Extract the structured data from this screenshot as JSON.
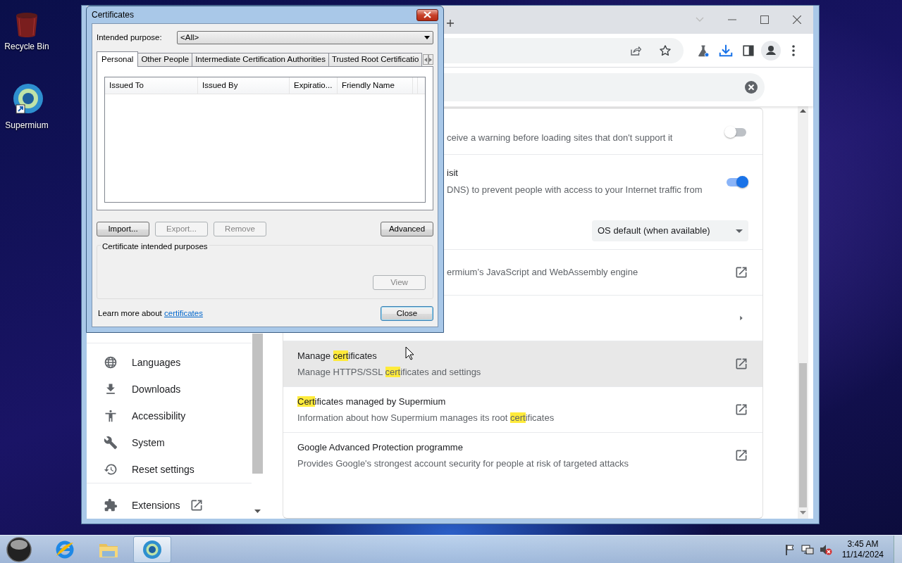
{
  "desktop_icons": [
    {
      "label": "Recycle Bin",
      "kind": "bin"
    },
    {
      "label": "Supermium",
      "kind": "browser"
    }
  ],
  "browser": {
    "sidebar": {
      "items": [
        {
          "label": "Languages",
          "kind": "languages"
        },
        {
          "label": "Downloads",
          "kind": "downloads"
        },
        {
          "label": "Accessibility",
          "kind": "accessibility"
        },
        {
          "label": "System",
          "kind": "system"
        },
        {
          "label": "Reset settings",
          "kind": "reset"
        },
        {
          "label": "Extensions",
          "kind": "extensions"
        }
      ]
    },
    "rows": [
      {
        "description": "ceive a warning before loading sites that don't support it",
        "control": {
          "kind": "toggle",
          "on": false
        },
        "hovered": false
      },
      {
        "title": "isit",
        "description": "DNS) to prevent people with access to your Internet traffic from",
        "control": {
          "kind": "toggle",
          "on": true
        },
        "select": {
          "value": "OS default (when available)"
        },
        "hovered": false
      },
      {
        "description": "ermium’s JavaScript and WebAssembly engine",
        "control": {
          "kind": "external"
        },
        "hovered": false
      },
      {
        "control": {
          "kind": "arrow"
        },
        "hovered": false
      },
      {
        "title": [
          {
            "text": "Manage ",
            "highlight": false
          },
          {
            "text": "cert",
            "highlight": true
          },
          {
            "text": "ificates",
            "highlight": false
          }
        ],
        "description": [
          {
            "text": "Manage HTTPS/SSL ",
            "highlight": false
          },
          {
            "text": "cert",
            "highlight": true
          },
          {
            "text": "ificates and settings",
            "highlight": false
          }
        ],
        "control": {
          "kind": "external"
        },
        "hovered": true
      },
      {
        "title": [
          {
            "text": "Cert",
            "highlight": true
          },
          {
            "text": "ificates managed by Supermium",
            "highlight": false
          }
        ],
        "description": [
          {
            "text": "Information about how Supermium manages its root ",
            "highlight": false
          },
          {
            "text": "cert",
            "highlight": true
          },
          {
            "text": "ificates",
            "highlight": false
          }
        ],
        "control": {
          "kind": "external"
        },
        "hovered": false
      },
      {
        "title": "Google Advanced Protection programme",
        "description": "Provides Google's strongest account security for people at risk of targeted attacks",
        "control": {
          "kind": "external"
        },
        "hovered": false
      }
    ]
  },
  "dialog": {
    "title": "Certificates",
    "purpose_label": "Intended purpose:",
    "purpose_value": "<All>",
    "tabs": [
      {
        "label": "Personal",
        "selected": true
      },
      {
        "label": "Other People",
        "selected": false
      },
      {
        "label": "Intermediate Certification Authorities",
        "selected": false
      },
      {
        "label": "Trusted Root Certificatio",
        "selected": false
      }
    ],
    "columns": [
      "Issued To",
      "Issued By",
      "Expiratio...",
      "Friendly Name"
    ],
    "buttons": [
      {
        "label": "Import...",
        "disabled": false
      },
      {
        "label": "Export...",
        "disabled": true
      },
      {
        "label": "Remove",
        "disabled": true
      }
    ],
    "advanced_button": {
      "label": "Advanced",
      "disabled": false
    },
    "group_label": "Certificate intended purposes",
    "view_button": {
      "label": "View",
      "disabled": true
    },
    "learn_more": {
      "text": "Learn more about ",
      "link": "certificates"
    },
    "close_button": {
      "label": "Close",
      "disabled": false
    }
  },
  "taskbar": {
    "apps": [
      {
        "kind": "ie",
        "active": false
      },
      {
        "kind": "folder",
        "active": false
      },
      {
        "kind": "browser",
        "active": true
      }
    ],
    "time": "3:45 AM",
    "date": "11/14/2024"
  }
}
